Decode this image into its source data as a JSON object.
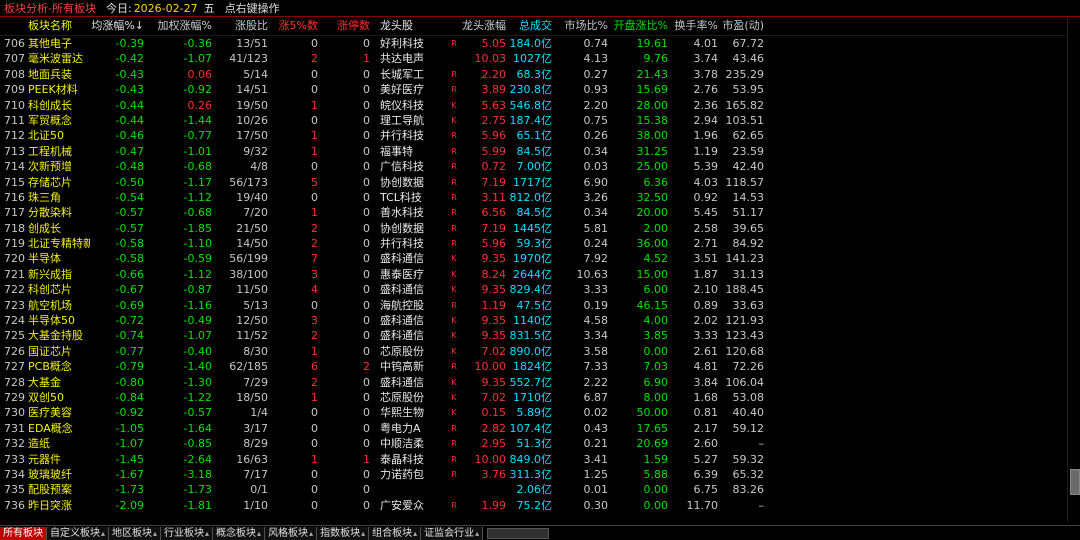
{
  "titlebar": {
    "title": "板块分析-所有板块",
    "today_label": "今日:",
    "date": "2026-02-27",
    "weekday": "五",
    "hint": "点右键操作"
  },
  "colors": {
    "up": "#ff3030",
    "down": "#00e000",
    "flat": "#c8c8c8",
    "name": "#f0f000",
    "turnover": "#00e0ff",
    "title": "#ff4040",
    "active_tab": "#c00000"
  },
  "columns": [
    {
      "key": "idx",
      "label": ""
    },
    {
      "key": "name",
      "label": "板块名称"
    },
    {
      "key": "avg",
      "label": "均涨幅%↓"
    },
    {
      "key": "wavg",
      "label": "加权涨幅%"
    },
    {
      "key": "ratio",
      "label": "涨股比"
    },
    {
      "key": "up5",
      "label": "涨5%数"
    },
    {
      "key": "limit",
      "label": "涨停数"
    },
    {
      "key": "lead",
      "label": "龙头股"
    },
    {
      "key": "flag",
      "label": ""
    },
    {
      "key": "leadpct",
      "label": "龙头涨幅%"
    },
    {
      "key": "turnover",
      "label": "总成交"
    },
    {
      "key": "mshare",
      "label": "市场比%"
    },
    {
      "key": "open",
      "label": "开盘涨比%"
    },
    {
      "key": "turnrate",
      "label": "换手率%"
    },
    {
      "key": "pe",
      "label": "市盈(动)"
    }
  ],
  "rows": [
    {
      "idx": "706",
      "name": "其他电子",
      "avg": "-0.39",
      "wavg": "-0.36",
      "ratio": "13/51",
      "up5": "0",
      "limit": "0",
      "lead": "好利科技",
      "flag": "R",
      "leadpct": "5.05",
      "turnover": "184.0亿",
      "mshare": "0.74",
      "open": "19.61",
      "turnrate": "4.01",
      "pe": "67.72"
    },
    {
      "idx": "707",
      "name": "毫米波雷达",
      "avg": "-0.42",
      "wavg": "-1.07",
      "ratio": "41/123",
      "up5": "2",
      "limit": "1",
      "lead": "共达电声",
      "flag": "",
      "leadpct": "10.03",
      "turnover": "1027亿",
      "mshare": "4.13",
      "open": "9.76",
      "turnrate": "3.74",
      "pe": "43.46"
    },
    {
      "idx": "708",
      "name": "地面兵装",
      "avg": "-0.43",
      "wavg": "0.06",
      "ratio": "5/14",
      "up5": "0",
      "limit": "0",
      "lead": "长城军工",
      "flag": "R",
      "leadpct": "2.20",
      "turnover": "68.3亿",
      "mshare": "0.27",
      "open": "21.43",
      "turnrate": "3.78",
      "pe": "235.29"
    },
    {
      "idx": "709",
      "name": "PEEK材料",
      "avg": "-0.43",
      "wavg": "-0.92",
      "ratio": "14/51",
      "up5": "0",
      "limit": "0",
      "lead": "美好医疗",
      "flag": "R",
      "leadpct": "3.89",
      "turnover": "230.8亿",
      "mshare": "0.93",
      "open": "15.69",
      "turnrate": "2.76",
      "pe": "53.95"
    },
    {
      "idx": "710",
      "name": "科创成长",
      "avg": "-0.44",
      "wavg": "0.26",
      "ratio": "19/50",
      "up5": "1",
      "limit": "0",
      "lead": "皖仪科技",
      "flag": "K",
      "leadpct": "5.63",
      "turnover": "546.8亿",
      "mshare": "2.20",
      "open": "28.00",
      "turnrate": "2.36",
      "pe": "165.82"
    },
    {
      "idx": "711",
      "name": "军贸概念",
      "avg": "-0.44",
      "wavg": "-1.44",
      "ratio": "10/26",
      "up5": "0",
      "limit": "0",
      "lead": "理工导航",
      "flag": "K",
      "leadpct": "2.75",
      "turnover": "187.4亿",
      "mshare": "0.75",
      "open": "15.38",
      "turnrate": "2.94",
      "pe": "103.51"
    },
    {
      "idx": "712",
      "name": "北证50",
      "avg": "-0.46",
      "wavg": "-0.77",
      "ratio": "17/50",
      "up5": "1",
      "limit": "0",
      "lead": "并行科技",
      "flag": "R",
      "leadpct": "5.96",
      "turnover": "65.1亿",
      "mshare": "0.26",
      "open": "38.00",
      "turnrate": "1.96",
      "pe": "62.65"
    },
    {
      "idx": "713",
      "name": "工程机械",
      "avg": "-0.47",
      "wavg": "-1.01",
      "ratio": "9/32",
      "up5": "1",
      "limit": "0",
      "lead": "福事特",
      "flag": "R",
      "leadpct": "5.99",
      "turnover": "84.5亿",
      "mshare": "0.34",
      "open": "31.25",
      "turnrate": "1.19",
      "pe": "23.59"
    },
    {
      "idx": "714",
      "name": "次新预增",
      "avg": "-0.48",
      "wavg": "-0.68",
      "ratio": "4/8",
      "up5": "0",
      "limit": "0",
      "lead": "广信科技",
      "flag": "R",
      "leadpct": "0.72",
      "turnover": "7.00亿",
      "mshare": "0.03",
      "open": "25.00",
      "turnrate": "5.39",
      "pe": "42.40"
    },
    {
      "idx": "715",
      "name": "存储芯片",
      "avg": "-0.50",
      "wavg": "-1.17",
      "ratio": "56/173",
      "up5": "5",
      "limit": "0",
      "lead": "协创数据",
      "flag": "R",
      "leadpct": "7.19",
      "turnover": "1717亿",
      "mshare": "6.90",
      "open": "6.36",
      "turnrate": "4.03",
      "pe": "118.57"
    },
    {
      "idx": "716",
      "name": "珠三角",
      "avg": "-0.54",
      "wavg": "-1.12",
      "ratio": "19/40",
      "up5": "0",
      "limit": "0",
      "lead": "TCL科技",
      "flag": "R",
      "leadpct": "3.11",
      "turnover": "812.0亿",
      "mshare": "3.26",
      "open": "32.50",
      "turnrate": "0.92",
      "pe": "14.53"
    },
    {
      "idx": "717",
      "name": "分散染料",
      "avg": "-0.57",
      "wavg": "-0.68",
      "ratio": "7/20",
      "up5": "1",
      "limit": "0",
      "lead": "善水科技",
      "flag": "R",
      "leadpct": "6.56",
      "turnover": "84.5亿",
      "mshare": "0.34",
      "open": "20.00",
      "turnrate": "5.45",
      "pe": "51.17"
    },
    {
      "idx": "718",
      "name": "创成长",
      "avg": "-0.57",
      "wavg": "-1.85",
      "ratio": "21/50",
      "up5": "2",
      "limit": "0",
      "lead": "协创数据",
      "flag": "R",
      "leadpct": "7.19",
      "turnover": "1445亿",
      "mshare": "5.81",
      "open": "2.00",
      "turnrate": "2.58",
      "pe": "39.65"
    },
    {
      "idx": "719",
      "name": "北证专精特新",
      "avg": "-0.58",
      "wavg": "-1.10",
      "ratio": "14/50",
      "up5": "2",
      "limit": "0",
      "lead": "并行科技",
      "flag": "R",
      "leadpct": "5.96",
      "turnover": "59.3亿",
      "mshare": "0.24",
      "open": "36.00",
      "turnrate": "2.71",
      "pe": "84.92"
    },
    {
      "idx": "720",
      "name": "半导体",
      "avg": "-0.58",
      "wavg": "-0.59",
      "ratio": "56/199",
      "up5": "7",
      "limit": "0",
      "lead": "盛科通信",
      "flag": "K",
      "leadpct": "9.35",
      "turnover": "1970亿",
      "mshare": "7.92",
      "open": "4.52",
      "turnrate": "3.51",
      "pe": "141.23"
    },
    {
      "idx": "721",
      "name": "新兴成指",
      "avg": "-0.66",
      "wavg": "-1.12",
      "ratio": "38/100",
      "up5": "3",
      "limit": "0",
      "lead": "惠泰医疗",
      "flag": "K",
      "leadpct": "8.24",
      "turnover": "2644亿",
      "mshare": "10.63",
      "open": "15.00",
      "turnrate": "1.87",
      "pe": "31.13"
    },
    {
      "idx": "722",
      "name": "科创芯片",
      "avg": "-0.67",
      "wavg": "-0.87",
      "ratio": "11/50",
      "up5": "4",
      "limit": "0",
      "lead": "盛科通信",
      "flag": "K",
      "leadpct": "9.35",
      "turnover": "829.4亿",
      "mshare": "3.33",
      "open": "6.00",
      "turnrate": "2.10",
      "pe": "188.45"
    },
    {
      "idx": "723",
      "name": "航空机场",
      "avg": "-0.69",
      "wavg": "-1.16",
      "ratio": "5/13",
      "up5": "0",
      "limit": "0",
      "lead": "海航控股",
      "flag": "R",
      "leadpct": "1.19",
      "turnover": "47.5亿",
      "mshare": "0.19",
      "open": "46.15",
      "turnrate": "0.89",
      "pe": "33.63"
    },
    {
      "idx": "724",
      "name": "半导体50",
      "avg": "-0.72",
      "wavg": "-0.49",
      "ratio": "12/50",
      "up5": "3",
      "limit": "0",
      "lead": "盛科通信",
      "flag": "K",
      "leadpct": "9.35",
      "turnover": "1140亿",
      "mshare": "4.58",
      "open": "4.00",
      "turnrate": "2.02",
      "pe": "121.93"
    },
    {
      "idx": "725",
      "name": "大基金持股",
      "avg": "-0.74",
      "wavg": "-1.07",
      "ratio": "11/52",
      "up5": "2",
      "limit": "0",
      "lead": "盛科通信",
      "flag": "K",
      "leadpct": "9.35",
      "turnover": "831.5亿",
      "mshare": "3.34",
      "open": "3.85",
      "turnrate": "3.33",
      "pe": "123.43"
    },
    {
      "idx": "726",
      "name": "国证芯片",
      "avg": "-0.77",
      "wavg": "-0.40",
      "ratio": "8/30",
      "up5": "1",
      "limit": "0",
      "lead": "芯原股份",
      "flag": "K",
      "leadpct": "7.02",
      "turnover": "890.0亿",
      "mshare": "3.58",
      "open": "0.00",
      "turnrate": "2.61",
      "pe": "120.68"
    },
    {
      "idx": "727",
      "name": "PCB概念",
      "avg": "-0.79",
      "wavg": "-1.40",
      "ratio": "62/185",
      "up5": "6",
      "limit": "2",
      "lead": "中钨高新",
      "flag": "R",
      "leadpct": "10.00",
      "turnover": "1824亿",
      "mshare": "7.33",
      "open": "7.03",
      "turnrate": "4.81",
      "pe": "72.26"
    },
    {
      "idx": "728",
      "name": "大基金",
      "avg": "-0.80",
      "wavg": "-1.30",
      "ratio": "7/29",
      "up5": "2",
      "limit": "0",
      "lead": "盛科通信",
      "flag": "K",
      "leadpct": "9.35",
      "turnover": "552.7亿",
      "mshare": "2.22",
      "open": "6.90",
      "turnrate": "3.84",
      "pe": "106.04"
    },
    {
      "idx": "729",
      "name": "双创50",
      "avg": "-0.84",
      "wavg": "-1.22",
      "ratio": "18/50",
      "up5": "1",
      "limit": "0",
      "lead": "芯原股份",
      "flag": "K",
      "leadpct": "7.02",
      "turnover": "1710亿",
      "mshare": "6.87",
      "open": "8.00",
      "turnrate": "1.68",
      "pe": "53.08"
    },
    {
      "idx": "730",
      "name": "医疗美容",
      "avg": "-0.92",
      "wavg": "-0.57",
      "ratio": "1/4",
      "up5": "0",
      "limit": "0",
      "lead": "华熙生物",
      "flag": "K",
      "leadpct": "0.15",
      "turnover": "5.89亿",
      "mshare": "0.02",
      "open": "50.00",
      "turnrate": "0.81",
      "pe": "40.40"
    },
    {
      "idx": "731",
      "name": "EDA概念",
      "avg": "-1.05",
      "wavg": "-1.64",
      "ratio": "3/17",
      "up5": "0",
      "limit": "0",
      "lead": "粤电力A",
      "flag": "R",
      "leadpct": "2.82",
      "turnover": "107.4亿",
      "mshare": "0.43",
      "open": "17.65",
      "turnrate": "2.17",
      "pe": "59.12"
    },
    {
      "idx": "732",
      "name": "造纸",
      "avg": "-1.07",
      "wavg": "-0.85",
      "ratio": "8/29",
      "up5": "0",
      "limit": "0",
      "lead": "中顺洁柔",
      "flag": "R",
      "leadpct": "2.95",
      "turnover": "51.3亿",
      "mshare": "0.21",
      "open": "20.69",
      "turnrate": "2.60",
      "pe": "–"
    },
    {
      "idx": "733",
      "name": "元器件",
      "avg": "-1.45",
      "wavg": "-2.64",
      "ratio": "16/63",
      "up5": "1",
      "limit": "1",
      "lead": "泰晶科技",
      "flag": "R",
      "leadpct": "10.00",
      "turnover": "849.0亿",
      "mshare": "3.41",
      "open": "1.59",
      "turnrate": "5.27",
      "pe": "59.32"
    },
    {
      "idx": "734",
      "name": "玻璃玻纤",
      "avg": "-1.67",
      "wavg": "-3.18",
      "ratio": "7/17",
      "up5": "0",
      "limit": "0",
      "lead": "力诺药包",
      "flag": "R",
      "leadpct": "3.76",
      "turnover": "311.3亿",
      "mshare": "1.25",
      "open": "5.88",
      "turnrate": "6.39",
      "pe": "65.32"
    },
    {
      "idx": "735",
      "name": "配股预案",
      "avg": "-1.73",
      "wavg": "-1.73",
      "ratio": "0/1",
      "up5": "0",
      "limit": "0",
      "lead": "",
      "flag": "",
      "leadpct": "",
      "turnover": "2.06亿",
      "mshare": "0.01",
      "open": "0.00",
      "turnrate": "6.75",
      "pe": "83.26"
    },
    {
      "idx": "736",
      "name": "昨日突涨",
      "avg": "-2.09",
      "wavg": "-1.81",
      "ratio": "1/10",
      "up5": "0",
      "limit": "0",
      "lead": "广安爱众",
      "flag": "R",
      "leadpct": "1.99",
      "turnover": "75.2亿",
      "mshare": "0.30",
      "open": "0.00",
      "turnrate": "11.70",
      "pe": "–"
    }
  ],
  "tabs": [
    {
      "label": "所有板块",
      "active": true,
      "dropdown": false
    },
    {
      "label": "自定义板块",
      "active": false,
      "dropdown": true
    },
    {
      "label": "地区板块",
      "active": false,
      "dropdown": true
    },
    {
      "label": "行业板块",
      "active": false,
      "dropdown": true
    },
    {
      "label": "概念板块",
      "active": false,
      "dropdown": true
    },
    {
      "label": "风格板块",
      "active": false,
      "dropdown": true
    },
    {
      "label": "指数板块",
      "active": false,
      "dropdown": true
    },
    {
      "label": "组合板块",
      "active": false,
      "dropdown": true
    },
    {
      "label": "证监会行业",
      "active": false,
      "dropdown": true
    }
  ],
  "icons": {
    "sort_indicator": "sort-desc-icon",
    "tab_dropdown": "dropdown-triangle-icon"
  }
}
